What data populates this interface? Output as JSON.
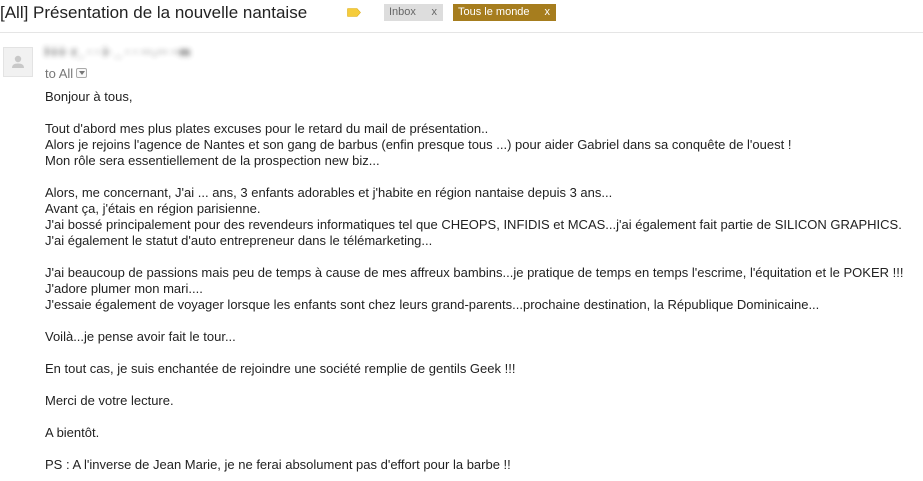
{
  "header": {
    "subject": "[All] Présentation de la nouvelle nantaise",
    "label_icon": "label-tag-icon",
    "label_icon_color": "#f5cc3b",
    "chips": [
      {
        "label": "Inbox",
        "remove": "x",
        "bg_color": "#dddddd",
        "text_color": "#666666"
      },
      {
        "label": "Tous le monde",
        "remove": "x",
        "bg_color": "#a67d1e",
        "text_color": "#ffffff"
      }
    ]
  },
  "message": {
    "avatar_icon": "person-icon",
    "sender": "l∙i∙i∙ r_ ∙ ∙ i∙ _ ∙ ∙ ∙∙∙.∙∙∙ ∙∙m",
    "recipients": "to All",
    "details_icon": "chevron-down-icon",
    "paragraphs": [
      [
        "Bonjour à tous,"
      ],
      [
        "Tout d'abord mes plus plates excuses pour le retard du mail de présentation..",
        "Alors je rejoins l'agence de Nantes et son gang de barbus (enfin presque tous ...) pour aider Gabriel dans sa conquête de l'ouest !",
        "Mon rôle sera essentiellement de la prospection new biz..."
      ],
      [
        "Alors, me concernant, J'ai ... ans, 3 enfants adorables et j'habite en région nantaise depuis 3 ans...",
        "Avant ça, j'étais en région parisienne.",
        "J'ai bossé principalement pour des revendeurs informatiques tel que CHEOPS, INFIDIS et MCAS...j'ai également fait partie de SILICON GRAPHICS.",
        "J'ai également le statut d'auto entrepreneur dans le télémarketing..."
      ],
      [
        "J'ai beaucoup de passions mais peu de temps à cause de mes affreux bambins...je pratique de temps en temps l'escrime, l'équitation et le POKER !!!",
        "J'adore plumer mon mari....",
        "J'essaie également de voyager lorsque les enfants sont chez leurs grand-parents...prochaine destination, la République Dominicaine..."
      ],
      [
        "Voilà...je pense avoir fait le tour..."
      ],
      [
        "En tout cas, je suis enchantée de rejoindre une société remplie de gentils Geek !!!"
      ],
      [
        "Merci de votre lecture."
      ],
      [
        "A bientôt."
      ],
      [
        "PS : A l'inverse de Jean Marie, je ne ferai absolument pas d'effort pour la barbe !!"
      ]
    ]
  }
}
